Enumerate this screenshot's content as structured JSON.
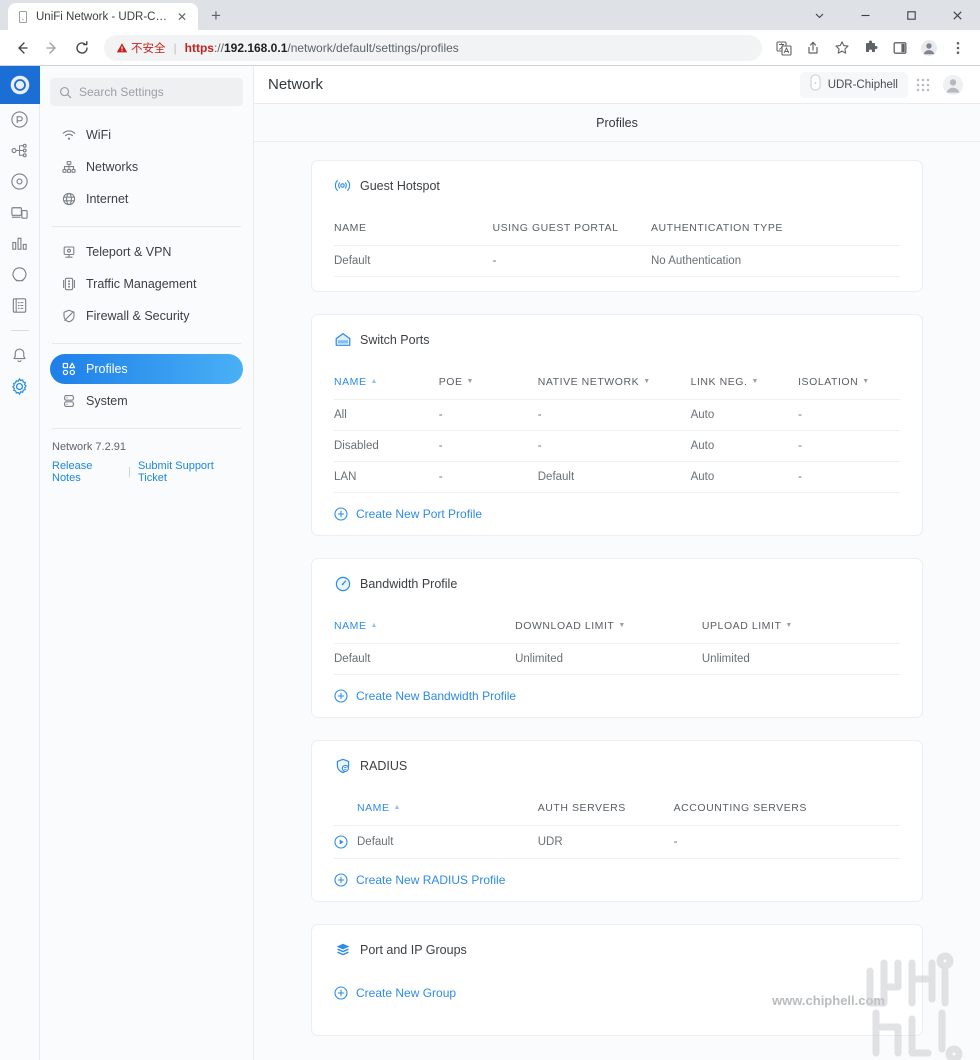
{
  "browser": {
    "tab": {
      "title": "UniFi Network - UDR-Chiphell",
      "favicon_name": "page-icon",
      "close_label": "✕"
    },
    "newtab_label": "+",
    "window_controls": {
      "minimize_tabs": "⌄",
      "minimize": "—",
      "maximize": "□",
      "close": "✕"
    },
    "nav": {
      "back": "←",
      "forward": "→",
      "reload": "⟳"
    },
    "omnibox": {
      "warning_glyph": "⚠",
      "security_label": "不安全",
      "separator": "|",
      "url_scheme": "https",
      "url_sep": "://",
      "url_host": "192.168.0.1",
      "url_path": "/network/default/settings/profiles"
    },
    "toolbar_right": [
      "translate-icon",
      "share-icon",
      "bookmark-star-icon",
      "extensions-icon",
      "sidepanel-icon",
      "profile-icon",
      "menu-icon"
    ]
  },
  "rail": {
    "logo_name": "unifi-logo",
    "items": [
      {
        "name": "rail-item-dashboard",
        "active": false
      },
      {
        "name": "rail-item-topology",
        "active": false
      },
      {
        "name": "rail-item-devices",
        "active": false
      },
      {
        "name": "rail-item-clients",
        "active": false
      },
      {
        "name": "rail-item-statistics",
        "active": false
      },
      {
        "name": "rail-item-hotspot",
        "active": false
      },
      {
        "name": "rail-item-logs",
        "active": false
      }
    ],
    "alerts_name": "rail-item-alerts",
    "settings_name": "rail-item-settings"
  },
  "sidebar": {
    "search": {
      "placeholder": "Search Settings",
      "value": ""
    },
    "groups": [
      {
        "items": [
          {
            "label": "WiFi",
            "icon": "wifi-icon",
            "active": false
          },
          {
            "label": "Networks",
            "icon": "networks-icon",
            "active": false
          },
          {
            "label": "Internet",
            "icon": "globe-icon",
            "active": false
          }
        ]
      },
      {
        "items": [
          {
            "label": "Teleport & VPN",
            "icon": "teleport-icon",
            "active": false
          },
          {
            "label": "Traffic Management",
            "icon": "traffic-icon",
            "active": false
          },
          {
            "label": "Firewall & Security",
            "icon": "shield-icon",
            "active": false
          }
        ]
      },
      {
        "items": [
          {
            "label": "Profiles",
            "icon": "profiles-icon",
            "active": true
          },
          {
            "label": "System",
            "icon": "system-icon",
            "active": false
          }
        ]
      }
    ],
    "version": "Network 7.2.91",
    "links": [
      {
        "label": "Release Notes"
      },
      {
        "label": "Submit Support Ticket"
      }
    ],
    "link_separator": "|"
  },
  "topbar": {
    "title": "Network",
    "device_name": "UDR-Chiphell",
    "device_icon": "device-icon",
    "apps_icon": "apps-grid-icon",
    "account_icon": "account-avatar-icon"
  },
  "page": {
    "title": "Profiles"
  },
  "cards": [
    {
      "id": "guest-hotspot",
      "title": "Guest Hotspot",
      "icon": "hotspot-icon",
      "columns": [
        {
          "label": "NAME",
          "sorted": false
        },
        {
          "label": "USING GUEST PORTAL",
          "sorted": false
        },
        {
          "label": "AUTHENTICATION TYPE",
          "sorted": false
        }
      ],
      "rows": [
        [
          "Default",
          "-",
          "No Authentication"
        ]
      ],
      "create_label": null
    },
    {
      "id": "switch-ports",
      "title": "Switch Ports",
      "icon": "switch-ports-icon",
      "columns": [
        {
          "label": "NAME",
          "sorted": true
        },
        {
          "label": "POE",
          "sorted": false
        },
        {
          "label": "NATIVE NETWORK",
          "sorted": false
        },
        {
          "label": "LINK NEG.",
          "sorted": false
        },
        {
          "label": "ISOLATION",
          "sorted": false
        }
      ],
      "rows": [
        [
          "All",
          "-",
          "-",
          "Auto",
          "-"
        ],
        [
          "Disabled",
          "-",
          "-",
          "Auto",
          "-"
        ],
        [
          "LAN",
          "-",
          "Default",
          "Auto",
          "-"
        ]
      ],
      "create_label": "Create New Port Profile"
    },
    {
      "id": "bandwidth-profile",
      "title": "Bandwidth Profile",
      "icon": "speedometer-icon",
      "columns": [
        {
          "label": "NAME",
          "sorted": true
        },
        {
          "label": "DOWNLOAD LIMIT",
          "sorted": false
        },
        {
          "label": "UPLOAD LIMIT",
          "sorted": false
        }
      ],
      "rows": [
        [
          "Default",
          "Unlimited",
          "Unlimited"
        ]
      ],
      "create_label": "Create New Bandwidth Profile"
    },
    {
      "id": "radius",
      "title": "RADIUS",
      "icon": "radius-shield-icon",
      "columns": [
        {
          "label": "NAME",
          "sorted": true
        },
        {
          "label": "AUTH SERVERS",
          "sorted": false
        },
        {
          "label": "ACCOUNTING SERVERS",
          "sorted": false
        }
      ],
      "rows": [
        [
          "Default",
          "UDR",
          "-"
        ]
      ],
      "row_icon": "play-circle-icon",
      "create_label": "Create New RADIUS Profile"
    },
    {
      "id": "port-ip-groups",
      "title": "Port and IP Groups",
      "icon": "layers-icon",
      "columns": [],
      "rows": [],
      "create_label": "Create New Group"
    }
  ],
  "watermark": {
    "text": "www.chiphell.com",
    "logo_name": "chiphell-logo"
  },
  "colors": {
    "accent": "#2d8bea",
    "active_nav_start": "#1e7fe8",
    "active_nav_end": "#49b0f5",
    "insecure_red": "#c5221f",
    "page_bg": "#fafbfc",
    "card_bg": "#ffffff"
  }
}
